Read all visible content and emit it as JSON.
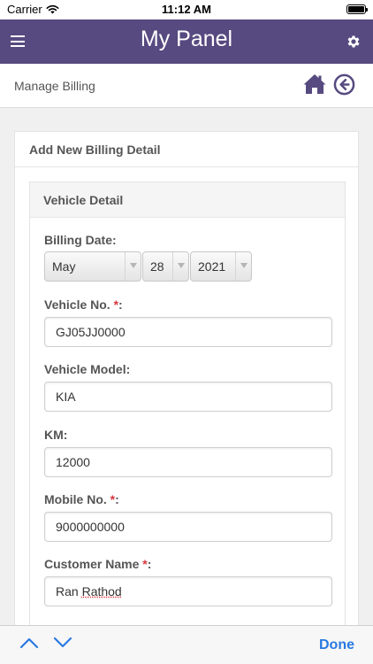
{
  "status": {
    "carrier": "Carrier",
    "time": "11:12 AM"
  },
  "navbar": {
    "title": "My Panel",
    "menu_icon": "hamburger-icon",
    "settings_icon": "gear-icon"
  },
  "subheader": {
    "title": "Manage Billing",
    "home_icon": "home-icon",
    "back_icon": "back-circle-icon"
  },
  "card": {
    "title": "Add New Billing Detail"
  },
  "panel": {
    "title": "Vehicle Detail"
  },
  "form": {
    "billing_date": {
      "label": "Billing Date:",
      "month": "May",
      "day": "28",
      "year": "2021"
    },
    "vehicle_no": {
      "label": "Vehicle No.",
      "required": "*",
      "colon": ":",
      "value": "GJ05JJ0000"
    },
    "vehicle_model": {
      "label": "Vehicle Model:",
      "value": "KIA"
    },
    "km": {
      "label": "KM:",
      "value": "12000"
    },
    "mobile_no": {
      "label": "Mobile No.",
      "required": "*",
      "colon": ":",
      "value": "9000000000"
    },
    "customer_name": {
      "label": "Customer Name",
      "required": "*",
      "colon": ":",
      "value_first": "Ran",
      "value_last": "Rathod"
    }
  },
  "toolbar": {
    "done_label": "Done",
    "prev_icon": "chevron-up-icon",
    "next_icon": "chevron-down-icon"
  },
  "colors": {
    "nav_bg": "#564a80",
    "accent_blue": "#2a7ae2",
    "required_red": "#d9363e"
  }
}
